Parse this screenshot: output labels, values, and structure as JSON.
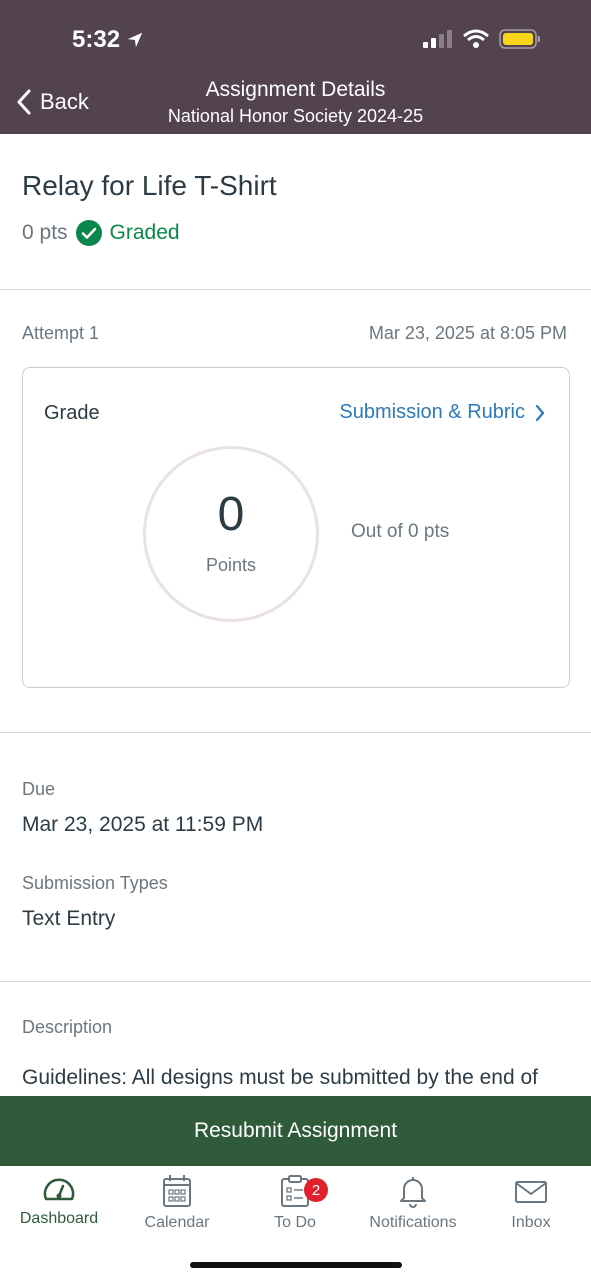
{
  "status_bar": {
    "time": "5:32"
  },
  "nav": {
    "back_label": "Back",
    "title": "Assignment Details",
    "subtitle": "National Honor Society 2024-25"
  },
  "assignment": {
    "title": "Relay for Life T-Shirt",
    "points": "0 pts",
    "status": "Graded"
  },
  "attempt": {
    "label": "Attempt 1",
    "date": "Mar 23, 2025 at 8:05 PM"
  },
  "grade_card": {
    "label": "Grade",
    "link": "Submission & Rubric",
    "score": "0",
    "score_label": "Points",
    "out_of": "Out of 0 pts"
  },
  "details": {
    "due_label": "Due",
    "due_value": "Mar 23, 2025 at 11:59 PM",
    "submission_types_label": "Submission Types",
    "submission_types_value": "Text Entry",
    "description_label": "Description",
    "description_text": "Guidelines: All designs must be submitted by the end of"
  },
  "resubmit_label": "Resubmit Assignment",
  "tabs": [
    {
      "label": "Dashboard",
      "icon": "dashboard-icon",
      "active": true
    },
    {
      "label": "Calendar",
      "icon": "calendar-icon"
    },
    {
      "label": "To Do",
      "icon": "todo-icon",
      "badge": "2"
    },
    {
      "label": "Notifications",
      "icon": "bell-icon"
    },
    {
      "label": "Inbox",
      "icon": "mail-icon"
    }
  ],
  "colors": {
    "header": "#52434f",
    "accent_green": "#2f5b3b",
    "graded_green": "#0b874b",
    "link_blue": "#2b7abc",
    "badge_red": "#e0202d"
  }
}
